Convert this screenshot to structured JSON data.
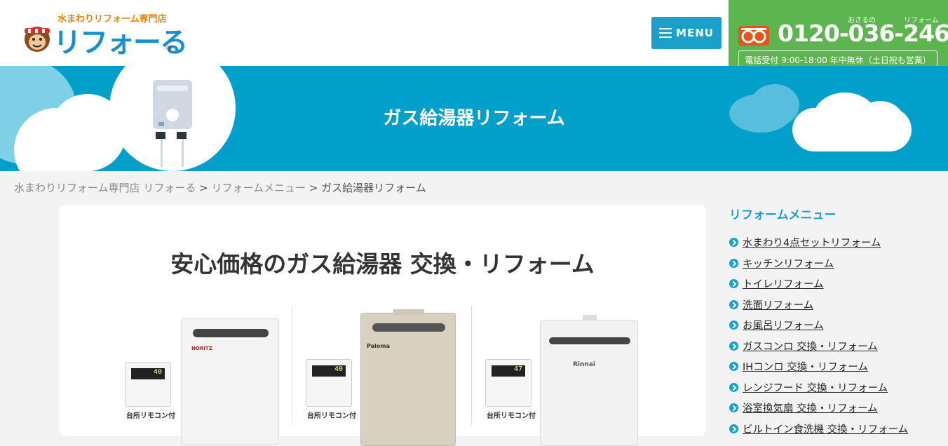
{
  "header": {
    "logo_tagline": "水まわりリフォーム専門店",
    "logo_name": "リフォーる",
    "logo_registered": "®",
    "menu_label": "MENU",
    "phone": {
      "ruby_1": "おさるの",
      "ruby_2": "リフォーム",
      "number": "0120-036-246",
      "hours": "電話受付 9:00-18:00 年中無休（土日祝も営業）"
    }
  },
  "hero": {
    "title": "ガス給湯器リフォーム"
  },
  "breadcrumb": {
    "items": [
      "水まわりリフォーム専門店 リフォーる",
      "リフォームメニュー",
      "ガス給湯器リフォーム"
    ],
    "separator": ">"
  },
  "main": {
    "title": "安心価格のガス給湯器 交換・リフォーム",
    "products": [
      {
        "brand": "NORITZ",
        "remote_label": "台所リモコン付",
        "display": "40"
      },
      {
        "brand": "Paloma",
        "remote_label": "台所リモコン付",
        "display": "40"
      },
      {
        "brand": "Rinnai",
        "remote_label": "台所リモコン付",
        "display": "47"
      }
    ]
  },
  "sidebar": {
    "title": "リフォームメニュー",
    "items": [
      "水まわり4点セットリフォーム",
      "キッチンリフォーム",
      "トイレリフォーム",
      "洗面リフォーム",
      "お風呂リフォーム",
      "ガスコンロ 交換・リフォーム",
      "IHコンロ 交換・リフォーム",
      "レンジフード 交換・リフォーム",
      "浴室換気扇 交換・リフォーム",
      "ビルトイン食洗機 交換・リフォーム"
    ]
  },
  "colors": {
    "accent": "#1aa0c9",
    "phone_bg": "#5cb54e",
    "hero_bg": "#00a0cb"
  }
}
